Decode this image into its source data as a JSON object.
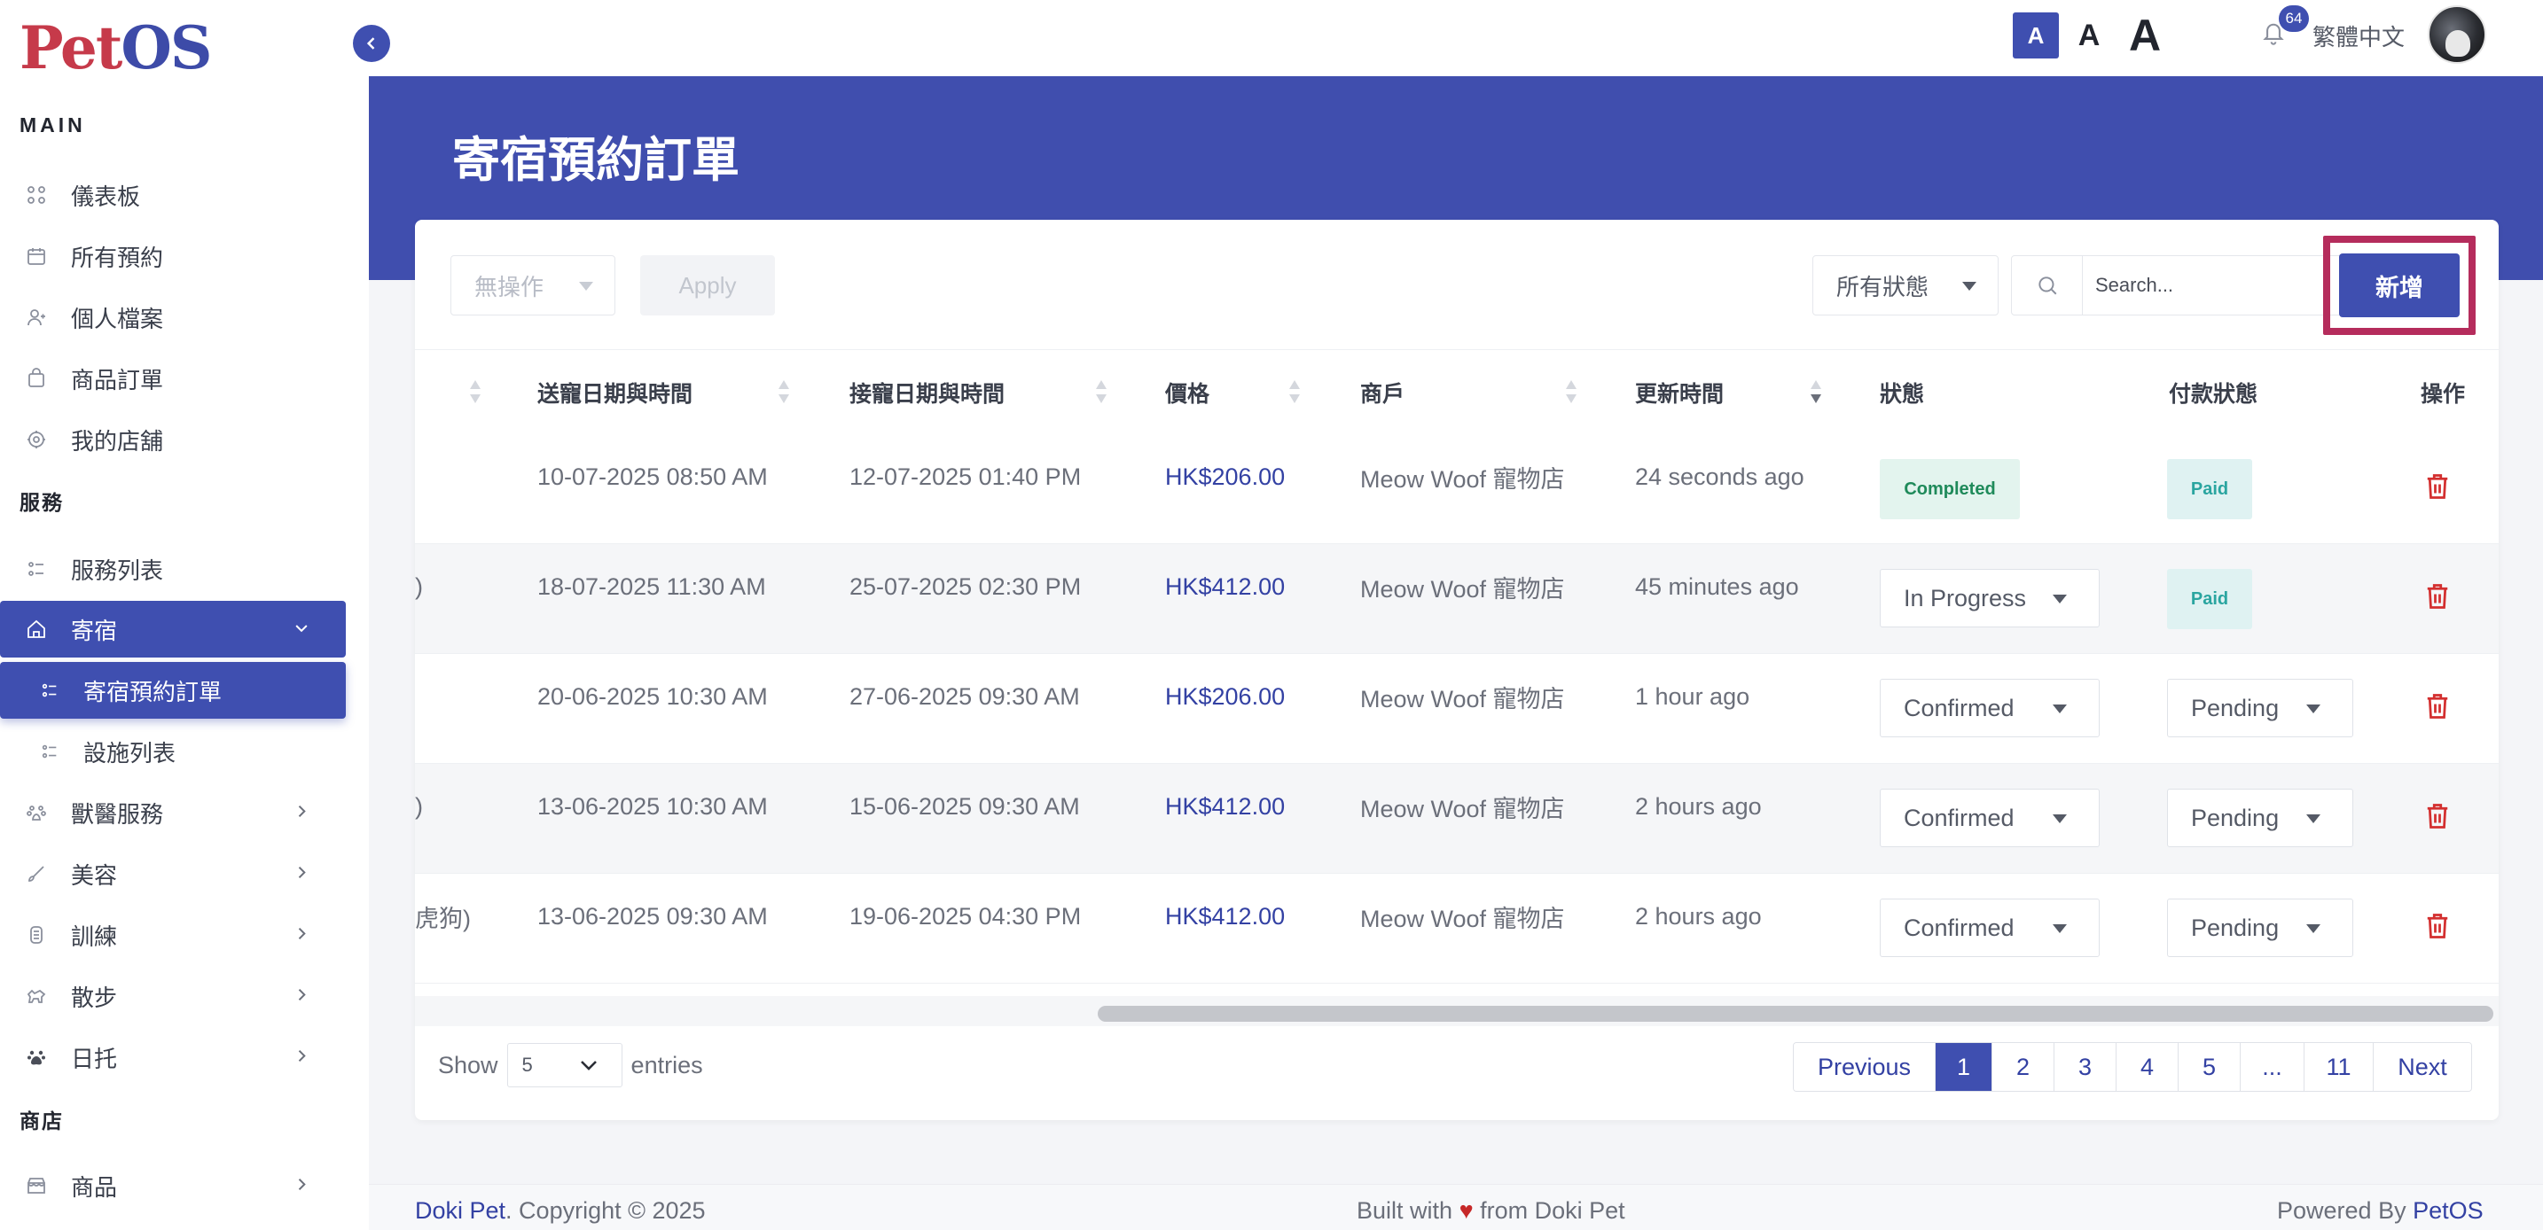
{
  "logo": {
    "part1": "Pet",
    "part2": "OS"
  },
  "sidebar": {
    "section_main": "MAIN",
    "section_service": "服務",
    "section_shop": "商店",
    "main_items": [
      {
        "label": "儀表板",
        "icon": "grid-icon"
      },
      {
        "label": "所有預約",
        "icon": "calendar-icon"
      },
      {
        "label": "個人檔案",
        "icon": "user-icon"
      },
      {
        "label": "商品訂單",
        "icon": "bag-icon"
      },
      {
        "label": "我的店舖",
        "icon": "store-icon"
      }
    ],
    "service_items": [
      {
        "label": "服務列表",
        "icon": "list-icon"
      },
      {
        "label": "寄宿",
        "icon": "home-icon",
        "active": true
      },
      {
        "label": "寄宿預約訂單",
        "icon": "list-icon",
        "sub": true,
        "active": true
      },
      {
        "label": "設施列表",
        "icon": "list-icon",
        "sub": true
      },
      {
        "label": "獸醫服務",
        "icon": "vet-icon"
      },
      {
        "label": "美容",
        "icon": "brush-icon"
      },
      {
        "label": "訓練",
        "icon": "training-icon"
      },
      {
        "label": "散步",
        "icon": "walk-icon"
      },
      {
        "label": "日托",
        "icon": "paw-icon"
      }
    ],
    "shop_items": [
      {
        "label": "商品",
        "icon": "shop-icon"
      }
    ]
  },
  "topbar": {
    "font_small": "A",
    "font_medium": "A",
    "font_large": "A",
    "notification_count": "64",
    "language": "繁體中文"
  },
  "page": {
    "title": "寄宿預約訂單"
  },
  "toolbar": {
    "bulk_action": "無操作",
    "apply": "Apply",
    "status_filter": "所有狀態",
    "search_placeholder": "Search...",
    "add": "新增"
  },
  "table": {
    "headers": [
      "送寵日期與時間",
      "接寵日期與時間",
      "價格",
      "商戶",
      "更新時間",
      "狀態",
      "付款狀態",
      "操作"
    ],
    "rows": [
      {
        "prefix": "",
        "dropoff": "10-07-2025 08:50 AM",
        "pickup": "12-07-2025 01:40 PM",
        "price": "HK$206.00",
        "merchant": "Meow Woof 寵物店",
        "updated": "24 seconds ago",
        "status": "Completed",
        "status_type": "badge",
        "payment": "Paid",
        "payment_type": "badge"
      },
      {
        "prefix": ")",
        "dropoff": "18-07-2025 11:30 AM",
        "pickup": "25-07-2025 02:30 PM",
        "price": "HK$412.00",
        "merchant": "Meow Woof 寵物店",
        "updated": "45 minutes ago",
        "status": "In Progress",
        "status_type": "select",
        "payment": "Paid",
        "payment_type": "badge"
      },
      {
        "prefix": "",
        "dropoff": "20-06-2025 10:30 AM",
        "pickup": "27-06-2025 09:30 AM",
        "price": "HK$206.00",
        "merchant": "Meow Woof 寵物店",
        "updated": "1 hour ago",
        "status": "Confirmed",
        "status_type": "select",
        "payment": "Pending",
        "payment_type": "select"
      },
      {
        "prefix": ")",
        "dropoff": "13-06-2025 10:30 AM",
        "pickup": "15-06-2025 09:30 AM",
        "price": "HK$412.00",
        "merchant": "Meow Woof 寵物店",
        "updated": "2 hours ago",
        "status": "Confirmed",
        "status_type": "select",
        "payment": "Pending",
        "payment_type": "select"
      },
      {
        "prefix": "虎狗)",
        "dropoff": "13-06-2025 09:30 AM",
        "pickup": "19-06-2025 04:30 PM",
        "price": "HK$412.00",
        "merchant": "Meow Woof 寵物店",
        "updated": "2 hours ago",
        "status": "Confirmed",
        "status_type": "select",
        "payment": "Pending",
        "payment_type": "select"
      }
    ]
  },
  "pagination": {
    "show": "Show",
    "entries_value": "5",
    "entries": "entries",
    "previous": "Previous",
    "pages": [
      "1",
      "2",
      "3",
      "4",
      "5",
      "...",
      "11"
    ],
    "current": "1",
    "next": "Next"
  },
  "footer": {
    "brand": "Doki Pet",
    "copyright": ". Copyright © 2025",
    "built_pre": "Built with",
    "built_post": "from Doki Pet",
    "powered_pre": "Powered By",
    "powered_brand": "PetOS"
  },
  "colors": {
    "primary": "#3f4fb0",
    "highlight": "#b52c5c",
    "logo_red": "#c63a4a",
    "logo_blue": "#3d4ba8"
  }
}
